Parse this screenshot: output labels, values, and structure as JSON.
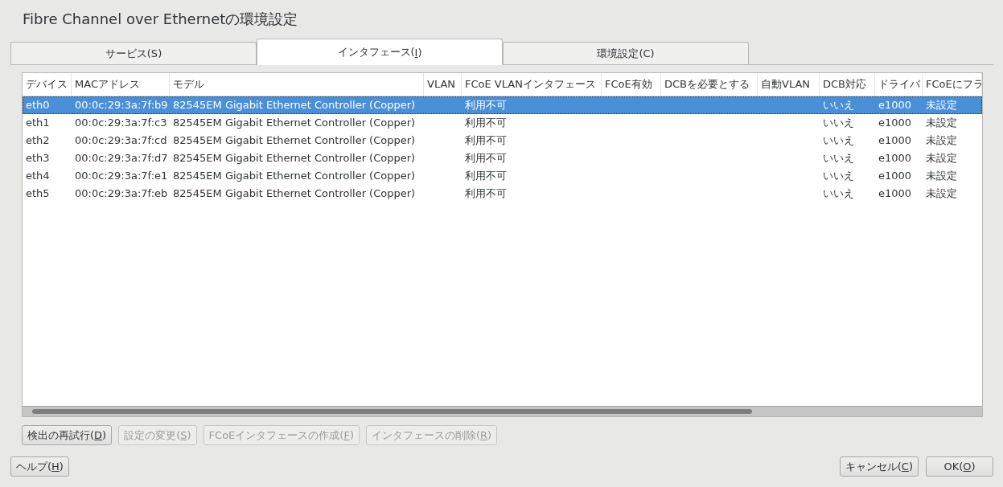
{
  "window": {
    "title": "Fibre Channel over Ethernetの環境設定"
  },
  "tabs": [
    {
      "prefix": "サービス(",
      "key": "S",
      "suffix": ")",
      "underline": false,
      "selected": false
    },
    {
      "prefix": "インタフェース(",
      "key": "I",
      "suffix": ")",
      "underline": true,
      "selected": true
    },
    {
      "prefix": "環境設定(",
      "key": "C",
      "suffix": ")",
      "underline": false,
      "selected": false
    }
  ],
  "table": {
    "columns": [
      "デバイス",
      "MACアドレス",
      "モデル",
      "VLAN",
      "FCoE VLANインタフェース",
      "FCoE有効",
      "DCBを必要とする",
      "自動VLAN",
      "DCB対応",
      "ドライバ",
      "FCoEにフラ"
    ],
    "rows": [
      {
        "device": "eth0",
        "mac": "00:0c:29:3a:7f:b9",
        "model": "82545EM Gigabit Ethernet Controller (Copper)",
        "fcoe_vlan": "利用不可",
        "dcb_capable": "いいえ",
        "driver": "e1000",
        "column_11": "未設定",
        "selected": true
      },
      {
        "device": "eth1",
        "mac": "00:0c:29:3a:7f:c3",
        "model": "82545EM Gigabit Ethernet Controller (Copper)",
        "fcoe_vlan": "利用不可",
        "dcb_capable": "いいえ",
        "driver": "e1000",
        "column_11": "未設定",
        "selected": false
      },
      {
        "device": "eth2",
        "mac": "00:0c:29:3a:7f:cd",
        "model": "82545EM Gigabit Ethernet Controller (Copper)",
        "fcoe_vlan": "利用不可",
        "dcb_capable": "いいえ",
        "driver": "e1000",
        "column_11": "未設定",
        "selected": false
      },
      {
        "device": "eth3",
        "mac": "00:0c:29:3a:7f:d7",
        "model": "82545EM Gigabit Ethernet Controller (Copper)",
        "fcoe_vlan": "利用不可",
        "dcb_capable": "いいえ",
        "driver": "e1000",
        "column_11": "未設定",
        "selected": false
      },
      {
        "device": "eth4",
        "mac": "00:0c:29:3a:7f:e1",
        "model": "82545EM Gigabit Ethernet Controller (Copper)",
        "fcoe_vlan": "利用不可",
        "dcb_capable": "いいえ",
        "driver": "e1000",
        "column_11": "未設定",
        "selected": false
      },
      {
        "device": "eth5",
        "mac": "00:0c:29:3a:7f:eb",
        "model": "82545EM Gigabit Ethernet Controller (Copper)",
        "fcoe_vlan": "利用不可",
        "dcb_capable": "いいえ",
        "driver": "e1000",
        "column_11": "未設定",
        "selected": false
      }
    ]
  },
  "actions": [
    {
      "prefix": "検出の再試行(",
      "key": "D",
      "suffix": ")",
      "disabled": false
    },
    {
      "prefix": "設定の変更(",
      "key": "S",
      "suffix": ")",
      "disabled": true
    },
    {
      "prefix": "FCoEインタフェースの作成(",
      "key": "F",
      "suffix": ")",
      "disabled": true
    },
    {
      "prefix": "インタフェースの削除(",
      "key": "R",
      "suffix": ")",
      "disabled": true
    }
  ],
  "help_button": {
    "prefix": "ヘルプ(",
    "key": "H",
    "suffix": ")"
  },
  "cancel_button": {
    "prefix": "キャンセル(",
    "key": "C",
    "suffix": ")"
  },
  "ok_button": {
    "prefix": "OK(",
    "key": "O",
    "suffix": ")"
  }
}
